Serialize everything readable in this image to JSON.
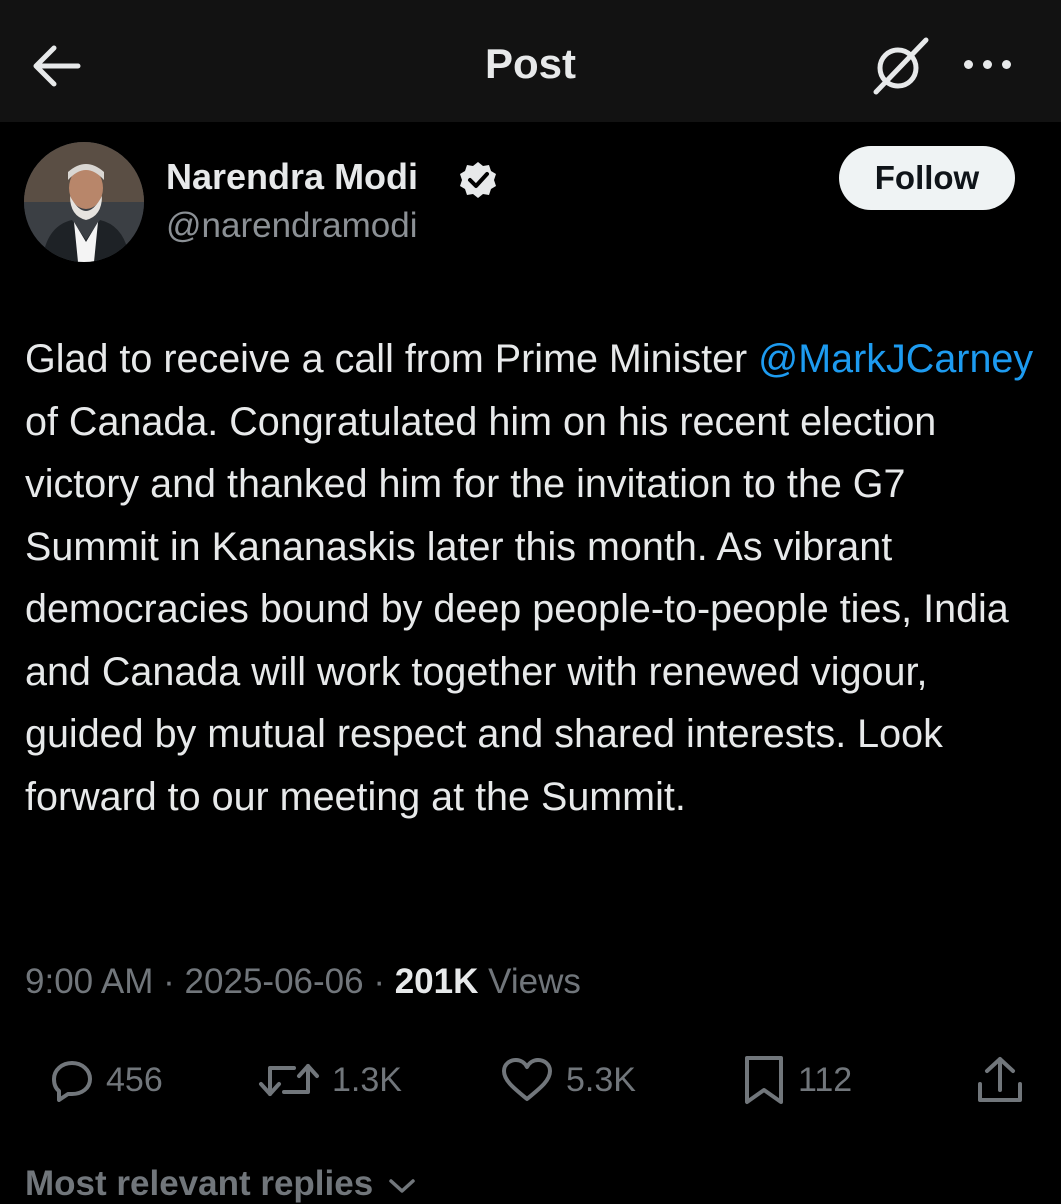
{
  "header": {
    "title": "Post",
    "back_icon": "arrow-left-icon",
    "grok_icon": "grok-icon",
    "more_icon": "ellipsis-icon"
  },
  "author": {
    "name": "Narendra Modi",
    "handle": "@narendramodi",
    "verified": true,
    "verified_color": "#1d9bf0",
    "follow_label": "Follow"
  },
  "post": {
    "text_before": "Glad to receive a call from Prime Minister ",
    "mention": "@MarkJCarney",
    "text_after": " of Canada. Congratulated him on his recent election victory and thanked him for the invitation to the G7 Summit in Kananaskis later this month. As vibrant democracies bound by deep people-to-people ties, India and Canada will work together with renewed vigour, guided by mutual respect and shared interests. Look forward to our meeting at the Summit.",
    "mention_color": "#1d9bf0"
  },
  "meta": {
    "time": "9:00 AM",
    "separator": "·",
    "date": "2025-06-06",
    "views_count": "201K",
    "views_label": "Views"
  },
  "actions": {
    "replies": "456",
    "reposts": "1.3K",
    "likes": "5.3K",
    "bookmarks": "112"
  },
  "replies_sort": {
    "label": "Most relevant replies"
  },
  "colors": {
    "background": "#000000",
    "header_background": "#121212",
    "text": "#e7e9ea",
    "muted": "#71767b",
    "accent": "#1d9bf0"
  }
}
